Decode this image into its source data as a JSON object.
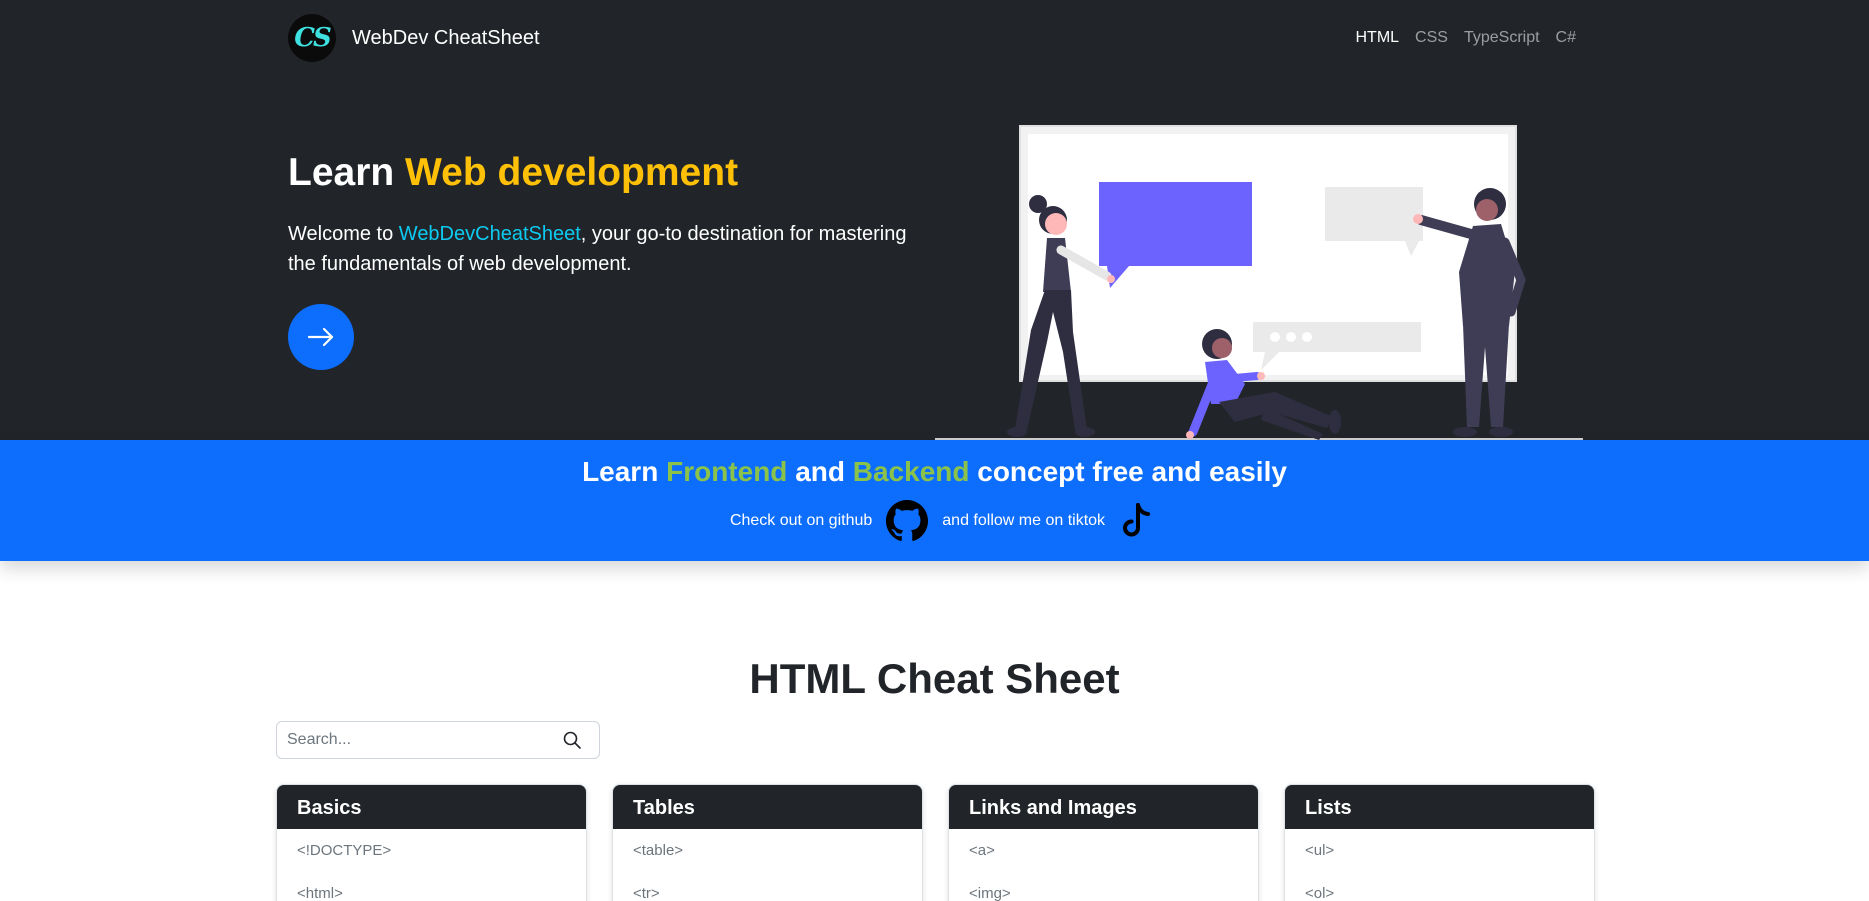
{
  "navbar": {
    "logo_text": "CS",
    "brand": "WebDev CheatSheet",
    "links": [
      "HTML",
      "CSS",
      "TypeScript",
      "C#"
    ],
    "active": "HTML"
  },
  "hero": {
    "title_plain": "Learn",
    "title_accent": "Web development",
    "desc_before": "Welcome to",
    "desc_link": "WebDevCheatSheet",
    "desc_after": ", your go-to destination for mastering the fundamentals of web development."
  },
  "banner": {
    "w1": "Learn",
    "w2": "Frontend",
    "w3": "and",
    "w4": "Backend",
    "w5": "concept free and easily",
    "github_text": "Check out on github",
    "tiktok_text": "and follow me on tiktok"
  },
  "main": {
    "title": "HTML Cheat Sheet",
    "search_placeholder": "Search...",
    "cards": [
      {
        "title": "Basics",
        "items": [
          "<!DOCTYPE>",
          "<html>"
        ]
      },
      {
        "title": "Tables",
        "items": [
          "<table>",
          "<tr>"
        ]
      },
      {
        "title": "Links and Images",
        "items": [
          "<a>",
          "<img>"
        ]
      },
      {
        "title": "Lists",
        "items": [
          "<ul>",
          "<ol>"
        ]
      }
    ]
  },
  "colors": {
    "dark": "#212529",
    "primary": "#0d6efd",
    "accent_yellow": "#ffc107",
    "accent_cyan": "#0dcaf0",
    "accent_green": "#8bc34a",
    "illustration_purple": "#6c63ff"
  },
  "icons": [
    "arrow-right-icon",
    "github-icon",
    "tiktok-icon",
    "search-icon"
  ]
}
